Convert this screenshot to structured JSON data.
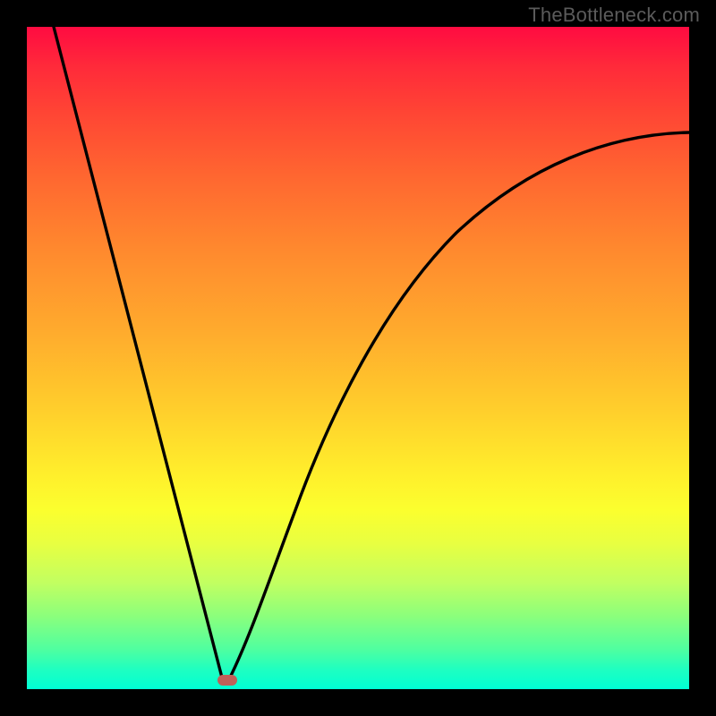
{
  "watermark": "TheBottleneck.com",
  "colors": {
    "frame": "#000000",
    "curve": "#000000",
    "marker": "#c06058",
    "gradient_top": "#ff0b41",
    "gradient_bottom": "#00ffd5",
    "watermark": "#5b5b5b"
  },
  "chart_data": {
    "type": "line",
    "title": "",
    "xlabel": "",
    "ylabel": "",
    "xlim": [
      0,
      100
    ],
    "ylim": [
      0,
      100
    ],
    "grid": false,
    "legend": false,
    "x": [
      4,
      10,
      15,
      20,
      25,
      29.5,
      30.7,
      35,
      40,
      47,
      55,
      65,
      75,
      88,
      100
    ],
    "values": [
      100,
      78,
      59,
      40.5,
      22,
      5.5,
      1.7,
      9,
      22,
      40,
      55,
      68,
      77,
      82,
      84
    ],
    "series": [
      {
        "name": "bottleneck-curve",
        "x": [
          4,
          10,
          15,
          20,
          25,
          29.5,
          30.7,
          35,
          40,
          47,
          55,
          65,
          75,
          88,
          100
        ],
        "values": [
          100,
          78,
          59,
          40.5,
          22,
          5.5,
          1.7,
          9,
          22,
          40,
          55,
          68,
          77,
          82,
          84
        ]
      }
    ],
    "annotations": [
      {
        "name": "optimal-point",
        "x": 30.1,
        "y": 1.4,
        "shape": "pill",
        "color": "#c06058"
      }
    ],
    "background": {
      "style": "vertical-gradient",
      "stops": [
        {
          "pos": 0.0,
          "color": "#ff0b41"
        },
        {
          "pos": 0.35,
          "color": "#ff8a2e"
        },
        {
          "pos": 0.68,
          "color": "#fff02c"
        },
        {
          "pos": 0.88,
          "color": "#8bff7c"
        },
        {
          "pos": 1.0,
          "color": "#00ffd5"
        }
      ]
    }
  }
}
